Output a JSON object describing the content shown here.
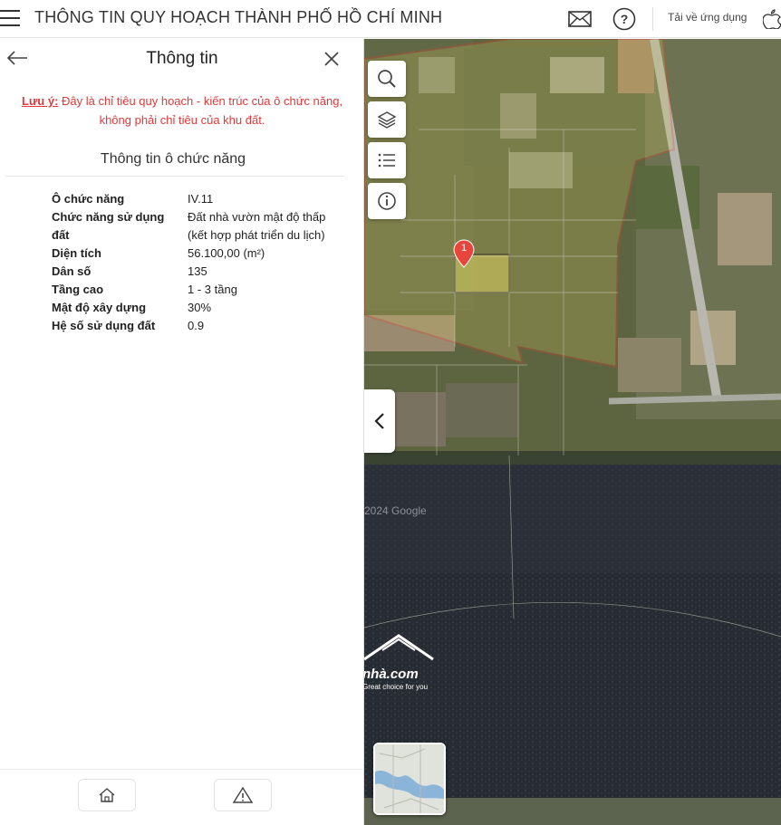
{
  "header": {
    "title": "THÔNG TIN QUY HOẠCH THÀNH PHỐ HỒ CHÍ MINH",
    "download_label": "Tải về ứng dụng",
    "icons": [
      "menu-icon",
      "mail-icon",
      "help-icon",
      "apple-icon"
    ]
  },
  "panel": {
    "title": "Thông tin",
    "note_label": "Lưu ý:",
    "note_text": " Đây là chỉ tiêu quy hoạch - kiến trúc của ô chức năng, không phải chỉ tiêu của khu đất.",
    "section_title": "Thông tin ô chức năng",
    "rows": [
      {
        "key": "Ô chức năng",
        "value": "IV.11"
      },
      {
        "key": "Chức năng sử dụng đất",
        "value": "Đất nhà vườn mật độ thấp (kết hợp phát triển du lịch)"
      },
      {
        "key": "Diện tích",
        "value": "56.100,00 (m²)"
      },
      {
        "key": "Dân số",
        "value": "135"
      },
      {
        "key": "Tầng cao",
        "value": "1 - 3 tầng"
      },
      {
        "key": "Mật độ xây dựng",
        "value": "30%"
      },
      {
        "key": "Hệ số sử dụng đất",
        "value": "0.9"
      }
    ]
  },
  "map": {
    "marker_label": "1",
    "watermark_text": "nhà.com",
    "watermark_sub": "Great choice for you",
    "copyright": "2024 Google",
    "tools": [
      "search-icon",
      "layers-icon",
      "list-icon",
      "info-icon"
    ],
    "colors": {
      "boundary": "#e8402e",
      "highlight": "#d8d060",
      "marker": "#e8453c"
    }
  }
}
